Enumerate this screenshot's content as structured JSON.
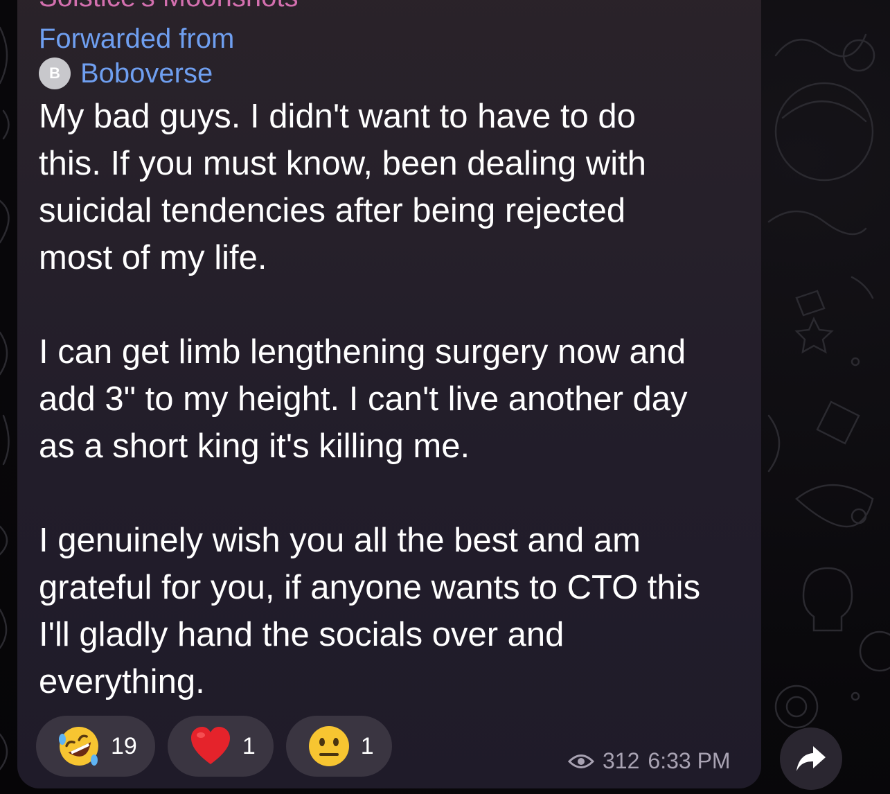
{
  "message": {
    "channel_name": "Solstice's Moonshots",
    "forwarded_label": "Forwarded from",
    "forwarded_avatar_letter": "B",
    "forwarded_name": "Boboverse",
    "paragraphs": [
      {
        "lines": [
          "My bad guys. I didn't want to have to do",
          "this. If you must know, been dealing with",
          "suicidal tendencies after being rejected",
          "most of my life."
        ]
      },
      {
        "lines": [
          "I can get limb lengthening surgery now and",
          "add 3\" to my height. I can't live another day",
          "as a short king it's killing me."
        ]
      },
      {
        "lines": [
          "I genuinely wish you all the best and am",
          "grateful for you, if anyone wants to CTO this",
          "I'll gladly hand the socials over and",
          "everything."
        ]
      }
    ],
    "reactions": [
      {
        "emoji": "rolling-on-floor-laughing",
        "count": "19"
      },
      {
        "emoji": "red-heart",
        "count": "1"
      },
      {
        "emoji": "neutral-face",
        "count": "1"
      }
    ],
    "views": "312",
    "time": "6:33 PM"
  },
  "icons": {
    "views": "eye-icon",
    "share": "share-arrow-icon"
  },
  "colors": {
    "bubble": "#26202a",
    "channel_name": "#d36fae",
    "link": "#6f9ff0",
    "text": "#ffffff",
    "meta": "#a9a3b3",
    "reaction_pill": "#3a3541"
  }
}
